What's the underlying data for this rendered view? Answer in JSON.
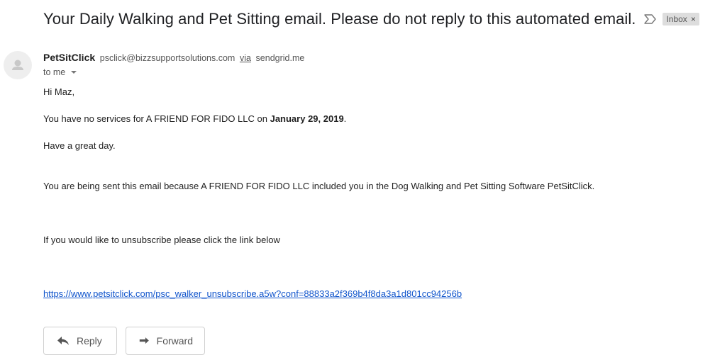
{
  "email": {
    "subject": "Your Daily Walking and Pet Sitting email. Please do not reply to this automated email.",
    "label": "Inbox",
    "label_remove": "×",
    "sender_name": "PetSitClick",
    "sender_email": "psclick@bizzsupportsolutions.com",
    "via_label": "via",
    "via_domain": "sendgrid.me",
    "to": "to me",
    "greeting": "Hi Maz,",
    "line1_prefix": "You have no services for A FRIEND FOR FIDO LLC on ",
    "line1_date": "January 29, 2019",
    "line1_suffix": ".",
    "line2": "Have a great day.",
    "line3": "You are being sent this email because A FRIEND FOR FIDO LLC included you in the Dog Walking and Pet Sitting Software PetSitClick.",
    "line4": "If you would like to unsubscribe please click the link below",
    "unsubscribe_link": "https://www.petsitclick.com/psc_walker_unsubscribe.a5w?conf=88833a2f369b4f8da3a1d801cc94256b"
  },
  "actions": {
    "reply_label": "Reply",
    "forward_label": "Forward"
  },
  "icons": {
    "importance": "importance-marker-icon",
    "avatar": "default-avatar-icon",
    "reply": "reply-arrow-icon",
    "forward": "forward-arrow-icon"
  }
}
